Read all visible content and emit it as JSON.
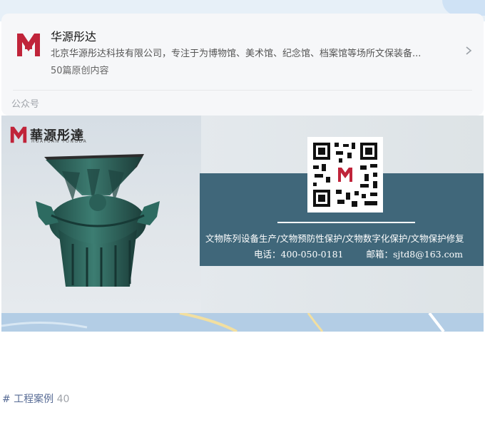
{
  "account": {
    "name": "华源彤达",
    "description": "北京华源彤达科技有限公司，专注于为博物馆、美术馆、纪念馆、档案馆等场所文保装备...",
    "article_count": "50篇原创内容",
    "type_label": "公众号"
  },
  "banner": {
    "brand_name": "華源彤達",
    "brand_sub": "HUAYUAN TONGDA",
    "services": "文物陈列设备生产/文物预防性保护/文物数字化保护/文物保护修复",
    "phone": "电话：400-050-0181",
    "email": "邮箱：sjtd8@163.com"
  },
  "tag": {
    "label": "# 工程案例",
    "count": "40"
  },
  "colors": {
    "accent": "#c0243a",
    "panel": "#40677a",
    "link": "#576b95"
  },
  "icons": [
    "brand-logo",
    "chevron-right-icon",
    "qr-code",
    "bronze-vessel-image"
  ]
}
